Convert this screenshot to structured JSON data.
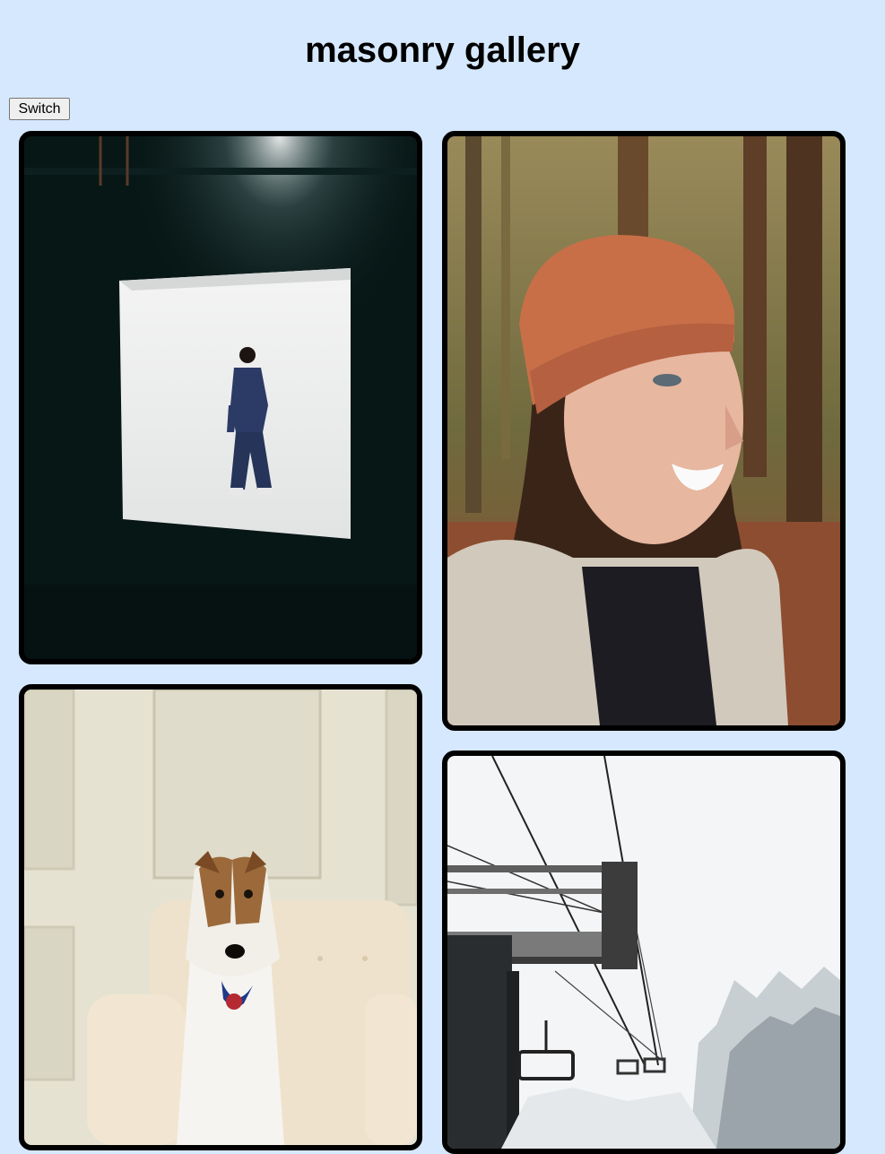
{
  "page": {
    "title": "masonry gallery",
    "switch_label": "Switch",
    "background": "#d6e8fd"
  },
  "gallery": {
    "items": [
      {
        "subject": "studio-photo"
      },
      {
        "subject": "portrait-photo"
      },
      {
        "subject": "dog-photo"
      },
      {
        "subject": "ski-lift-photo"
      }
    ]
  }
}
